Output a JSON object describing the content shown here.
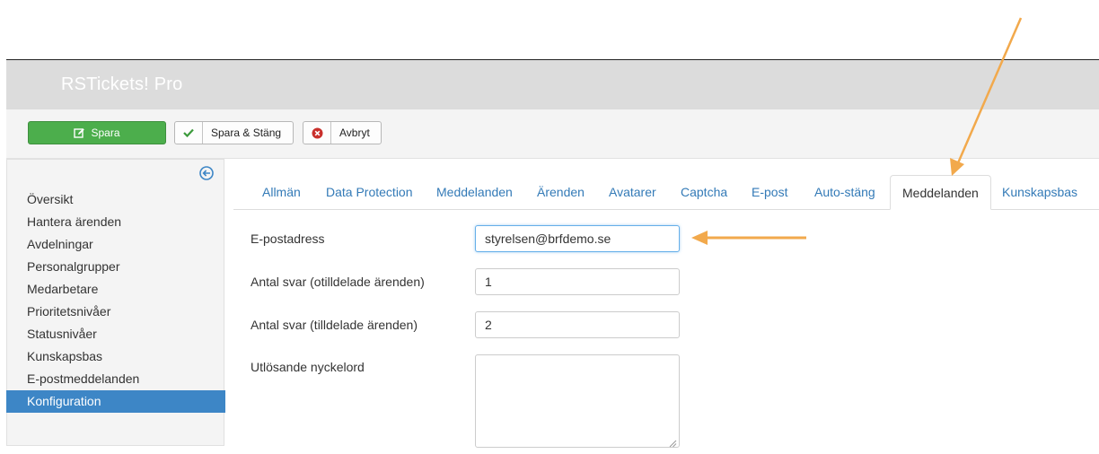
{
  "header": {
    "app_title": "RSTickets! Pro"
  },
  "toolbar": {
    "save_label": "Spara",
    "save_close_label": "Spara & Stäng",
    "cancel_label": "Avbryt"
  },
  "sidebar": {
    "items": [
      {
        "label": "Översikt",
        "active": false
      },
      {
        "label": "Hantera ärenden",
        "active": false
      },
      {
        "label": "Avdelningar",
        "active": false
      },
      {
        "label": "Personalgrupper",
        "active": false
      },
      {
        "label": "Medarbetare",
        "active": false
      },
      {
        "label": "Prioritetsnivåer",
        "active": false
      },
      {
        "label": "Statusnivåer",
        "active": false
      },
      {
        "label": "Kunskapsbas",
        "active": false
      },
      {
        "label": "E-postmeddelanden",
        "active": false
      },
      {
        "label": "Konfiguration",
        "active": true
      }
    ]
  },
  "tabs": [
    {
      "label": "Allmän"
    },
    {
      "label": "Data Protection"
    },
    {
      "label": "Meddelanden"
    },
    {
      "label": "Ärenden"
    },
    {
      "label": "Avatarer"
    },
    {
      "label": "Captcha"
    },
    {
      "label": "E-post"
    },
    {
      "label": "Auto-stäng"
    },
    {
      "label": "Meddelanden",
      "active": true
    },
    {
      "label": "Kunskapsbas"
    }
  ],
  "form": {
    "email_label": "E-postadress",
    "email_value": "styrelsen@brfdemo.se",
    "replies_unassigned_label": "Antal svar (otilldelade ärenden)",
    "replies_unassigned_value": "1",
    "replies_assigned_label": "Antal svar (tilldelade ärenden)",
    "replies_assigned_value": "2",
    "trigger_keywords_label": "Utlösande nyckelord",
    "trigger_keywords_value": ""
  },
  "colors": {
    "save_green": "#4cae4c",
    "active_blue": "#3d86c6",
    "link_blue": "#337ab7",
    "annotation_orange": "#f2a94c"
  },
  "icons": {
    "save": "edit-icon",
    "save_close": "check-icon",
    "cancel": "close-circle-icon",
    "collapse": "arrow-left-circle-icon"
  }
}
